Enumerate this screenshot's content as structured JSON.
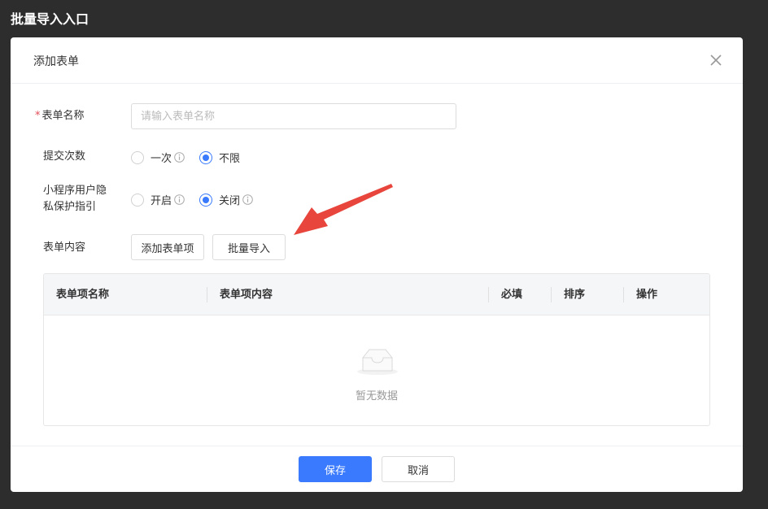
{
  "page": {
    "title": "批量导入入口"
  },
  "modal": {
    "title": "添加表单",
    "form": {
      "name": {
        "required_mark": "*",
        "label": "表单名称",
        "placeholder": "请输入表单名称",
        "value": ""
      },
      "submit_count": {
        "label": "提交次数",
        "options": [
          {
            "label": "一次",
            "checked": false,
            "info": true
          },
          {
            "label": "不限",
            "checked": true,
            "info": false
          }
        ]
      },
      "privacy": {
        "label_line1": "小程序用户隐",
        "label_line2": "私保护指引",
        "options": [
          {
            "label": "开启",
            "checked": false,
            "info": true
          },
          {
            "label": "关闭",
            "checked": true,
            "info": true
          }
        ]
      },
      "content": {
        "label": "表单内容",
        "add_item_label": "添加表单项",
        "batch_import_label": "批量导入"
      }
    },
    "table": {
      "columns": [
        "表单项名称",
        "表单项内容",
        "必填",
        "排序",
        "操作"
      ],
      "rows": [],
      "empty_text": "暂无数据"
    },
    "footer": {
      "save_label": "保存",
      "cancel_label": "取消"
    }
  },
  "colors": {
    "primary": "#3a7afe",
    "annotation_arrow": "#e8453c",
    "required": "#e34d59"
  },
  "icons": {
    "close": "close-icon",
    "info": "info-icon",
    "empty": "empty-box-icon",
    "annotation": "red-arrow-annotation"
  }
}
